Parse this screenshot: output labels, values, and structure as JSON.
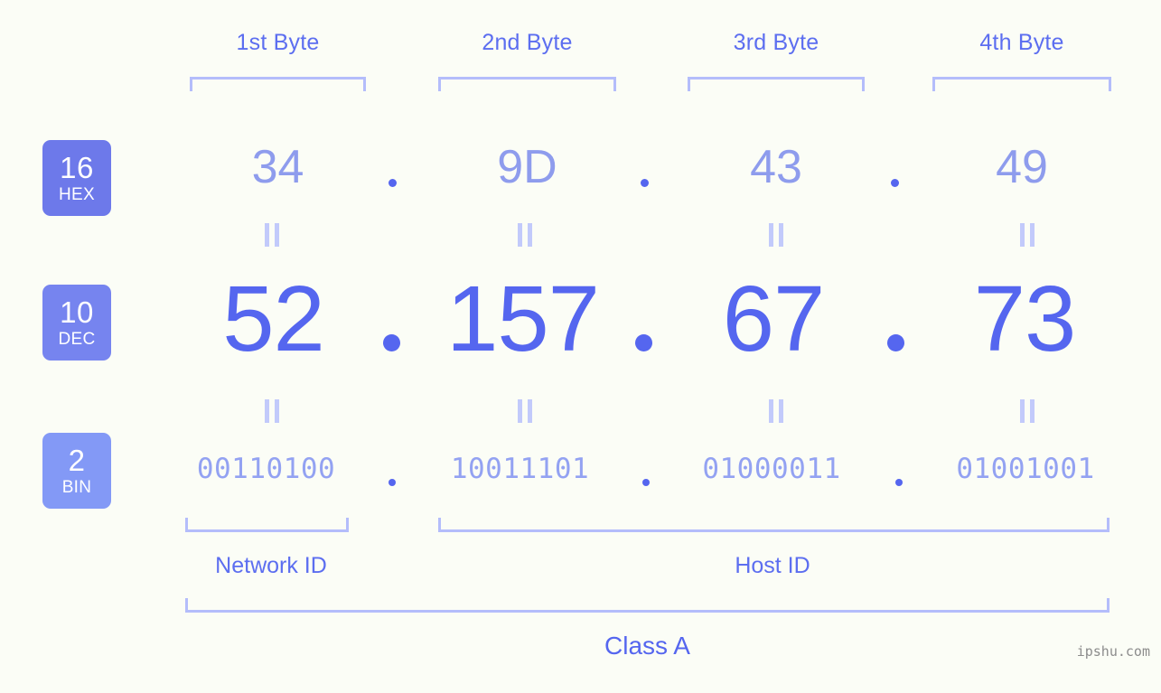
{
  "page": {
    "background_color": "#fbfdf6",
    "accent_color": "#5566ef",
    "light_accent_color": "#b4bdfb",
    "watermark": "ipshu.com"
  },
  "byte_headers": [
    {
      "label": "1st Byte"
    },
    {
      "label": "2nd Byte"
    },
    {
      "label": "3rd Byte"
    },
    {
      "label": "4th Byte"
    }
  ],
  "bases": [
    {
      "number": "16",
      "name": "HEX",
      "color": "#6d79ea"
    },
    {
      "number": "10",
      "name": "DEC",
      "color": "#7684ef"
    },
    {
      "number": "2",
      "name": "BIN",
      "color": "#8399f6"
    }
  ],
  "rows": {
    "hex": {
      "values": [
        "34",
        "9D",
        "43",
        "49"
      ],
      "separator": "."
    },
    "dec": {
      "values": [
        "52",
        "157",
        "67",
        "73"
      ],
      "separator": "."
    },
    "bin": {
      "values": [
        "00110100",
        "10011101",
        "01000011",
        "01001001"
      ],
      "separator": "."
    }
  },
  "equals_marks": {
    "glyph": "||",
    "count_per_row": 4
  },
  "regions": [
    {
      "label": "Network ID"
    },
    {
      "label": "Host ID"
    }
  ],
  "class": {
    "label": "Class A"
  }
}
